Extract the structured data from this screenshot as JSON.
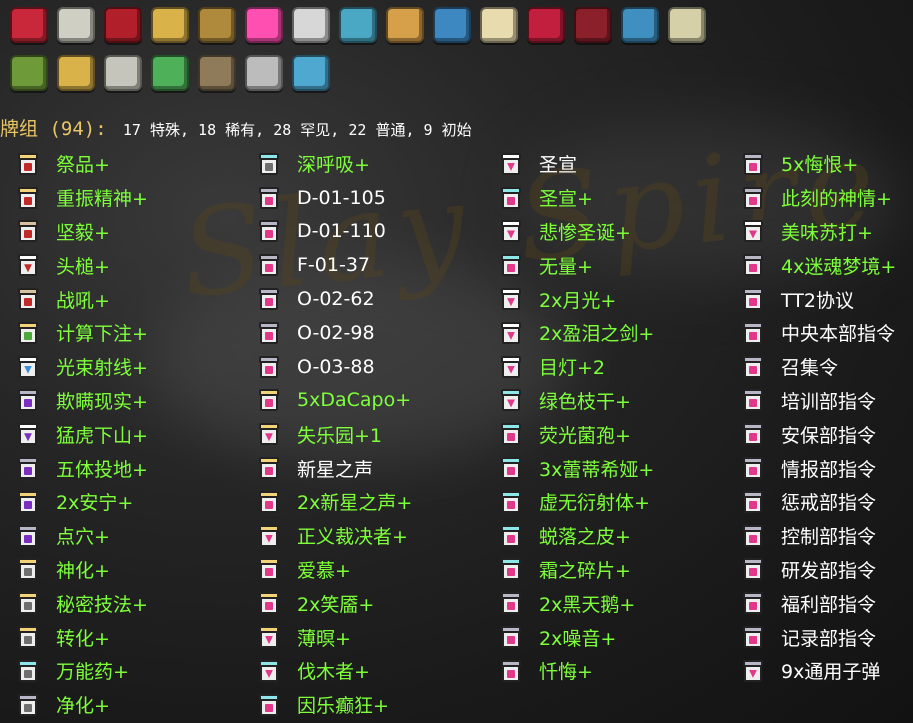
{
  "relics": {
    "row1": [
      "red-seal-icon",
      "envelope-icon",
      "red-shield-icon",
      "gold-leaves-icon",
      "compass-icon",
      "pink-flame-icon",
      "notebook-icon",
      "pin-cushion-icon",
      "potted-flower-icon",
      "anchor-icon",
      "sticky-note-icon",
      "swirl-orb-icon",
      "open-book-icon",
      "bead-bracelet-icon",
      "teacup-icon"
    ],
    "row2": [
      "green-urn-icon",
      "feather-icon",
      "fish-bone-icon",
      "map-icon",
      "wooden-board-icon",
      "syringe-icon",
      "cleat-icon"
    ]
  },
  "relic_colors": {
    "row1": [
      "#c8283a",
      "#cfcfc4",
      "#b01f2a",
      "#d9b24a",
      "#b08a3c",
      "#ff4fb0",
      "#d7d7d7",
      "#4aa8c4",
      "#d6a04a",
      "#3d88c0",
      "#e8dcae",
      "#c21f3e",
      "#8b1f2a",
      "#3f8fc0",
      "#d6d0a8"
    ],
    "row2": [
      "#6f9a3a",
      "#d9b24a",
      "#c5c5bb",
      "#4fb05a",
      "#8f7a5a",
      "#bcbcbc",
      "#4fa8d0"
    ]
  },
  "deck": {
    "title": "牌组 (94):",
    "counts": "17 特殊, 18 稀有, 28 罕见, 22 普通, 9 初始"
  },
  "columns": [
    [
      {
        "name": "祭品+",
        "up": true,
        "jar": "red",
        "lid": "#f3d37a"
      },
      {
        "name": "重振精神+",
        "up": true,
        "jar": "red",
        "lid": "#f3d37a"
      },
      {
        "name": "坚毅+",
        "up": true,
        "jar": "red",
        "lid": "#d7c0a0"
      },
      {
        "name": "头槌+",
        "up": true,
        "jar": "red",
        "lid": "#ffffff",
        "v": true
      },
      {
        "name": "战吼+",
        "up": true,
        "jar": "red",
        "lid": "#d7c0a0"
      },
      {
        "name": "计算下注+",
        "up": true,
        "jar": "green",
        "lid": "#f3d37a"
      },
      {
        "name": "光束射线+",
        "up": true,
        "jar": "blue",
        "lid": "#ffffff",
        "v": true
      },
      {
        "name": "欺瞒现实+",
        "up": true,
        "jar": "purple",
        "lid": "#b7b7c8"
      },
      {
        "name": "猛虎下山+",
        "up": true,
        "jar": "purple",
        "lid": "#ffffff",
        "v": true
      },
      {
        "name": "五体投地+",
        "up": true,
        "jar": "purple",
        "lid": "#b7b7c8"
      },
      {
        "name": "2x安宁+",
        "up": true,
        "jar": "purple",
        "lid": "#f3d37a"
      },
      {
        "name": "点穴+",
        "up": true,
        "jar": "purple",
        "lid": "#b7b7c8"
      },
      {
        "name": "神化+",
        "up": true,
        "jar": "gray",
        "lid": "#f3d37a"
      },
      {
        "name": "秘密技法+",
        "up": true,
        "jar": "gray",
        "lid": "#f3d37a"
      },
      {
        "name": "转化+",
        "up": true,
        "jar": "gray",
        "lid": "#f3d37a"
      },
      {
        "name": "万能药+",
        "up": true,
        "jar": "gray",
        "lid": "#8fe6ea"
      },
      {
        "name": "净化+",
        "up": true,
        "jar": "gray",
        "lid": "#b7b7c8"
      }
    ],
    [
      {
        "name": "深呼吸+",
        "up": true,
        "jar": "gray",
        "lid": "#8fe6ea"
      },
      {
        "name": "D-01-105",
        "up": false,
        "jar": "pink",
        "lid": "#b7b7c8"
      },
      {
        "name": "D-01-110",
        "up": false,
        "jar": "pink",
        "lid": "#b7b7c8"
      },
      {
        "name": "F-01-37",
        "up": false,
        "jar": "pink",
        "lid": "#b7b7c8"
      },
      {
        "name": "O-02-62",
        "up": false,
        "jar": "pink",
        "lid": "#b7b7c8"
      },
      {
        "name": "O-02-98",
        "up": false,
        "jar": "pink",
        "lid": "#b7b7c8"
      },
      {
        "name": "O-03-88",
        "up": false,
        "jar": "pink",
        "lid": "#b7b7c8"
      },
      {
        "name": "5xDaCapo+",
        "up": true,
        "jar": "pink",
        "lid": "#f3d37a"
      },
      {
        "name": "失乐园+1",
        "up": true,
        "jar": "pink",
        "lid": "#f3d37a",
        "v": true
      },
      {
        "name": "新星之声",
        "up": false,
        "jar": "pink",
        "lid": "#f3d37a"
      },
      {
        "name": "2x新星之声+",
        "up": true,
        "jar": "pink",
        "lid": "#f3d37a"
      },
      {
        "name": "正义裁决者+",
        "up": true,
        "jar": "pink",
        "lid": "#f3d37a",
        "v": true
      },
      {
        "name": "爱慕+",
        "up": true,
        "jar": "pink",
        "lid": "#f3d37a"
      },
      {
        "name": "2x笑靥+",
        "up": true,
        "jar": "pink",
        "lid": "#f3d37a"
      },
      {
        "name": "薄暝+",
        "up": true,
        "jar": "pink",
        "lid": "#f3d37a",
        "v": true
      },
      {
        "name": "伐木者+",
        "up": true,
        "jar": "pink",
        "lid": "#8fe6ea",
        "v": true
      },
      {
        "name": "因乐癫狂+",
        "up": true,
        "jar": "pink",
        "lid": "#8fe6ea"
      }
    ],
    [
      {
        "name": "圣宣",
        "up": false,
        "jar": "pink",
        "lid": "#ffffff",
        "v": true
      },
      {
        "name": "圣宣+",
        "up": true,
        "jar": "pink",
        "lid": "#8fe6ea"
      },
      {
        "name": "悲惨圣诞+",
        "up": true,
        "jar": "pink",
        "lid": "#ffffff",
        "v": true
      },
      {
        "name": "无量+",
        "up": true,
        "jar": "pink",
        "lid": "#8fe6ea"
      },
      {
        "name": "2x月光+",
        "up": true,
        "jar": "pink",
        "lid": "#ffffff",
        "v": true
      },
      {
        "name": "2x盈泪之剑+",
        "up": true,
        "jar": "pink",
        "lid": "#ffffff",
        "v": true
      },
      {
        "name": "目灯+2",
        "up": true,
        "jar": "pink",
        "lid": "#ffffff",
        "v": true
      },
      {
        "name": "绿色枝干+",
        "up": true,
        "jar": "pink",
        "lid": "#8fe6ea",
        "v": true
      },
      {
        "name": "荧光菌孢+",
        "up": true,
        "jar": "pink",
        "lid": "#8fe6ea"
      },
      {
        "name": "3x蕾蒂希娅+",
        "up": true,
        "jar": "pink",
        "lid": "#8fe6ea"
      },
      {
        "name": "虚无衍射体+",
        "up": true,
        "jar": "pink",
        "lid": "#8fe6ea"
      },
      {
        "name": "蜕落之皮+",
        "up": true,
        "jar": "pink",
        "lid": "#8fe6ea"
      },
      {
        "name": "霜之碎片+",
        "up": true,
        "jar": "pink",
        "lid": "#8fe6ea"
      },
      {
        "name": "2x黑天鹅+",
        "up": true,
        "jar": "pink",
        "lid": "#b7b7c8"
      },
      {
        "name": "2x噪音+",
        "up": true,
        "jar": "pink",
        "lid": "#b7b7c8"
      },
      {
        "name": "忏悔+",
        "up": true,
        "jar": "pink",
        "lid": "#b7b7c8"
      }
    ],
    [
      {
        "name": "5x悔恨+",
        "up": true,
        "jar": "pink",
        "lid": "#b7b7c8"
      },
      {
        "name": "此刻的神情+",
        "up": true,
        "jar": "pink",
        "lid": "#b7b7c8"
      },
      {
        "name": "美味苏打+",
        "up": true,
        "jar": "pink",
        "lid": "#ffffff",
        "v": true
      },
      {
        "name": "4x迷魂梦境+",
        "up": true,
        "jar": "pink",
        "lid": "#b7b7c8"
      },
      {
        "name": "TT2协议",
        "up": false,
        "jar": "pink",
        "lid": "#b7b7c8"
      },
      {
        "name": "中央本部指令",
        "up": false,
        "jar": "pink",
        "lid": "#b7b7c8"
      },
      {
        "name": "召集令",
        "up": false,
        "jar": "pink",
        "lid": "#b7b7c8"
      },
      {
        "name": "培训部指令",
        "up": false,
        "jar": "pink",
        "lid": "#b7b7c8"
      },
      {
        "name": "安保部指令",
        "up": false,
        "jar": "pink",
        "lid": "#b7b7c8"
      },
      {
        "name": "情报部指令",
        "up": false,
        "jar": "pink",
        "lid": "#b7b7c8"
      },
      {
        "name": "惩戒部指令",
        "up": false,
        "jar": "pink",
        "lid": "#b7b7c8"
      },
      {
        "name": "控制部指令",
        "up": false,
        "jar": "pink",
        "lid": "#b7b7c8"
      },
      {
        "name": "研发部指令",
        "up": false,
        "jar": "pink",
        "lid": "#b7b7c8"
      },
      {
        "name": "福利部指令",
        "up": false,
        "jar": "pink",
        "lid": "#b7b7c8"
      },
      {
        "name": "记录部指令",
        "up": false,
        "jar": "pink",
        "lid": "#b7b7c8"
      },
      {
        "name": "9x通用子弹",
        "up": false,
        "jar": "pink",
        "lid": "#b7b7c8",
        "v": true
      }
    ]
  ],
  "jar_colors": {
    "red": "#c22a2a",
    "green": "#4caa3a",
    "blue": "#3a8fd8",
    "purple": "#7a2fc0",
    "gray": "#6f6f6f",
    "pink": "#e1388a"
  },
  "colors": {
    "upgraded": "#7dff3a",
    "base": "#ffffff",
    "title": "#e8c565"
  }
}
